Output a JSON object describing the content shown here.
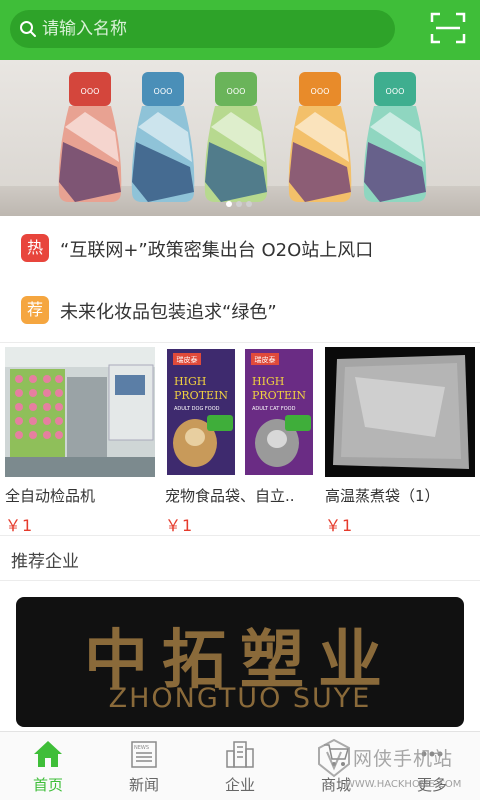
{
  "colors": {
    "brand_green": "#3fbe39",
    "price_red": "#e53b2c",
    "hot_badge": "#e8453c",
    "recommend_badge": "#f5a640"
  },
  "search": {
    "placeholder": "请输入名称",
    "icon": "search-icon"
  },
  "header": {
    "scan_icon": "scan-icon"
  },
  "banner": {
    "slide_count": 3,
    "active_index": 0
  },
  "news": [
    {
      "badge": "热",
      "badge_color": "#e8453c",
      "title": "“互联网+”政策密集出台 O2O站上风口"
    },
    {
      "badge": "荐",
      "badge_color": "#f5a640",
      "title": "未来化妆品包装追求“绿色”"
    }
  ],
  "products": [
    {
      "name": "全自动检品机",
      "price": "￥1"
    },
    {
      "name": "宠物食品袋、自立..",
      "price": "￥1"
    },
    {
      "name": "高温蒸煮袋（1）",
      "price": "￥1"
    }
  ],
  "product_images": {
    "pouch_brand": "瑞皮泰",
    "pouch_title_1": "HIGH",
    "pouch_title_2": "PROTEIN",
    "dog_food": "ADULT DOG FOOD",
    "cat_food": "ADULT CAT FOOD"
  },
  "recommended": {
    "title": "推荐企业",
    "company_cn": "中拓塑业",
    "company_en": "ZHONGTUO SUYE"
  },
  "tabs": [
    {
      "label": "首页",
      "icon": "home-icon",
      "active": true
    },
    {
      "label": "新闻",
      "icon": "news-icon",
      "active": false
    },
    {
      "label": "企业",
      "icon": "building-icon",
      "active": false
    },
    {
      "label": "商城",
      "icon": "cart-icon",
      "active": false
    },
    {
      "label": "更多",
      "icon": "more-icon",
      "active": false
    }
  ],
  "watermark": {
    "text": "网侠手机站",
    "url": "WWW.HACKHOME.COM"
  }
}
